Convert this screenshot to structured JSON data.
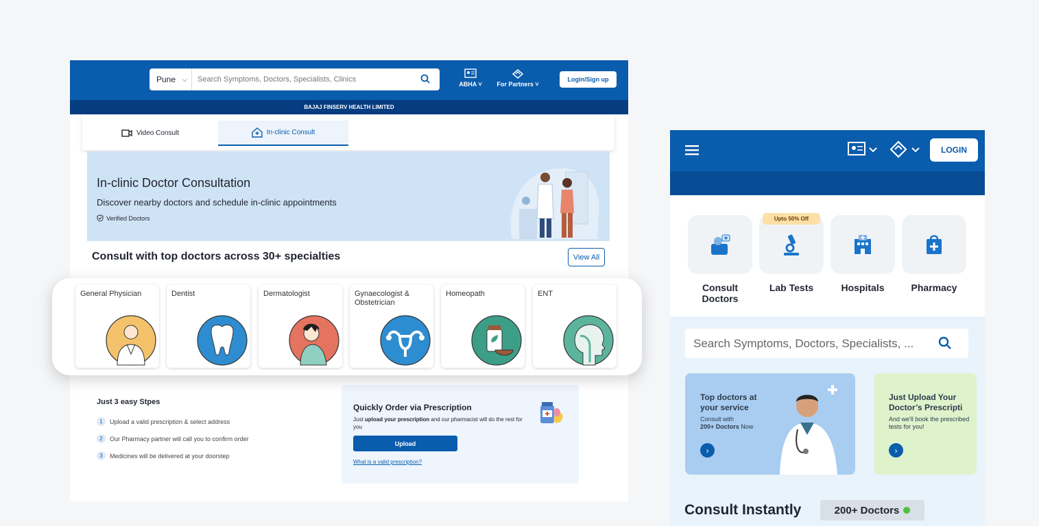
{
  "desktop": {
    "city": "Pune",
    "search_placeholder": "Search Symptoms, Doctors, Specialists, Clinics",
    "abha": "ABHA",
    "partners": "For Partners",
    "login": "Login/Sign up",
    "company": "BAJAJ FINSERV HEALTH LIMITED",
    "tabs": {
      "video": "Video Consult",
      "clinic": "In-clinic Consult"
    },
    "hero": {
      "title": "In-clinic Doctor Consultation",
      "subtitle": "Discover nearby doctors and schedule in-clinic appointments",
      "verified": "Verified Doctors"
    },
    "specialties_title": "Consult with top doctors across 30+ specialties",
    "view_all": "View All",
    "specialties": [
      {
        "name": "General Physician",
        "color": "#f4c26b"
      },
      {
        "name": "Dentist",
        "color": "#2e8dd0"
      },
      {
        "name": "Dermatologist",
        "color": "#e4735f"
      },
      {
        "name": "Gynaecologist & Obstetrician",
        "color": "#2e8dd0"
      },
      {
        "name": "Homeopath",
        "color": "#3d9e88"
      },
      {
        "name": "ENT",
        "color": "#5cb49c"
      }
    ],
    "steps": {
      "heading": "Just 3 easy Stpes",
      "items": [
        {
          "num": "1",
          "text": "Upload a valid prescription & select address"
        },
        {
          "num": "2",
          "text": "Our Pharmacy partner will call you to confirm order"
        },
        {
          "num": "3",
          "text": "Medicines will be delivered at your doorstep"
        }
      ]
    },
    "prescription": {
      "title": "Quickly Order via Prescription",
      "desc_pre": "Just ",
      "desc_bold": "upload your prescription",
      "desc_post": " and our pharmacist will do the rest for you",
      "upload": "Upload",
      "link": "What is a valid prescription?"
    }
  },
  "mobile": {
    "login": "LOGIN",
    "offer": "Upto 50% Off",
    "services": [
      {
        "label": "Consult Doctors",
        "icon": "doctor-icon"
      },
      {
        "label": "Lab Tests",
        "icon": "microscope-icon"
      },
      {
        "label": "Hospitals",
        "icon": "hospital-icon"
      },
      {
        "label": "Pharmacy",
        "icon": "pharmacy-bag-icon"
      }
    ],
    "search_placeholder": "Search Symptoms, Doctors, Specialists, ...",
    "card1": {
      "title": "Top doctors at your service",
      "line1": "Consult with",
      "bold": "200+ Doctors",
      "line2": " Now"
    },
    "card2": {
      "title": "Just Upload Your Doctor’s Prescripti",
      "sub": "And we'll book the prescribed tests for you!"
    },
    "consult_instantly": "Consult Instantly",
    "doctors_badge": "200+ Doctors"
  }
}
